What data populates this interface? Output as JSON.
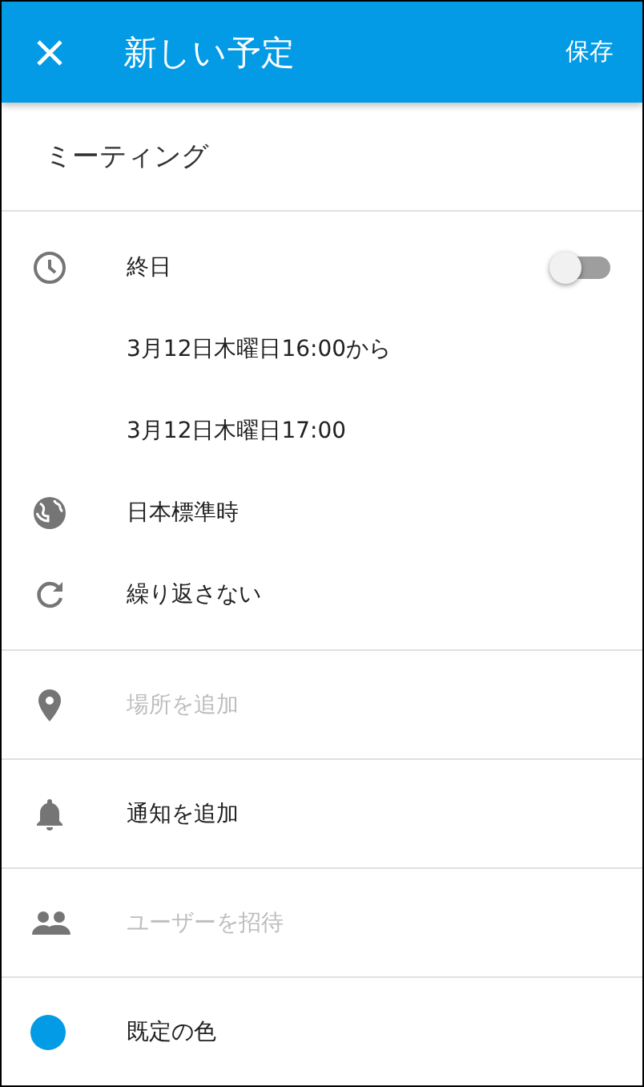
{
  "header": {
    "title": "新しい予定",
    "save": "保存"
  },
  "title_field": {
    "value": "ミーティング"
  },
  "all_day": {
    "label": "終日",
    "on": false
  },
  "start": "3月12日木曜日16:00から",
  "end": "3月12日木曜日17:00",
  "timezone": "日本標準時",
  "repeat": "繰り返さない",
  "location": {
    "placeholder": "場所を追加"
  },
  "notification": "通知を追加",
  "invite": {
    "placeholder": "ユーザーを招待"
  },
  "event_color": {
    "label": "既定の色",
    "color": "#039be5"
  }
}
